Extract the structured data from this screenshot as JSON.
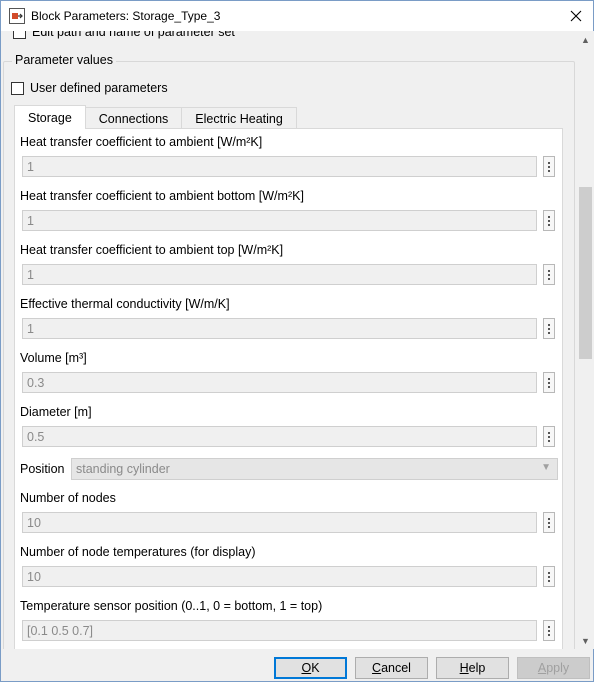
{
  "window": {
    "title": "Block Parameters: Storage_Type_3"
  },
  "partial_row": {
    "label": "Edit path and name of parameter set"
  },
  "group": {
    "title": "Parameter values",
    "user_defined_label": "User defined parameters"
  },
  "tabs": [
    {
      "label": "Storage"
    },
    {
      "label": "Connections"
    },
    {
      "label": "Electric Heating"
    }
  ],
  "params": [
    {
      "label": "Heat transfer coefficient to ambient [W/m²K]",
      "value": "1"
    },
    {
      "label": "Heat transfer coefficient to ambient bottom [W/m²K]",
      "value": "1"
    },
    {
      "label": "Heat transfer coefficient to ambient top [W/m²K]",
      "value": "1"
    },
    {
      "label": "Effective thermal conductivity [W/m/K]",
      "value": "1"
    },
    {
      "label": "Volume [m³]",
      "value": "0.3"
    },
    {
      "label": "Diameter [m]",
      "value": "0.5"
    }
  ],
  "position": {
    "label": "Position",
    "value": "standing cylinder"
  },
  "params2": [
    {
      "label": "Number of nodes",
      "value": "10"
    },
    {
      "label": "Number of node temperatures (for display)",
      "value": "10"
    },
    {
      "label": "Temperature sensor position (0..1, 0 = bottom, 1 = top)",
      "value": "[0.1 0.5 0.7]"
    }
  ],
  "buttons": {
    "ok_prefix": "",
    "ok_u": "O",
    "ok_rest": "K",
    "cancel_prefix": "",
    "cancel_u": "C",
    "cancel_rest": "ancel",
    "help_prefix": "",
    "help_u": "H",
    "help_rest": "elp",
    "apply_prefix": "",
    "apply_u": "A",
    "apply_rest": "pply"
  }
}
